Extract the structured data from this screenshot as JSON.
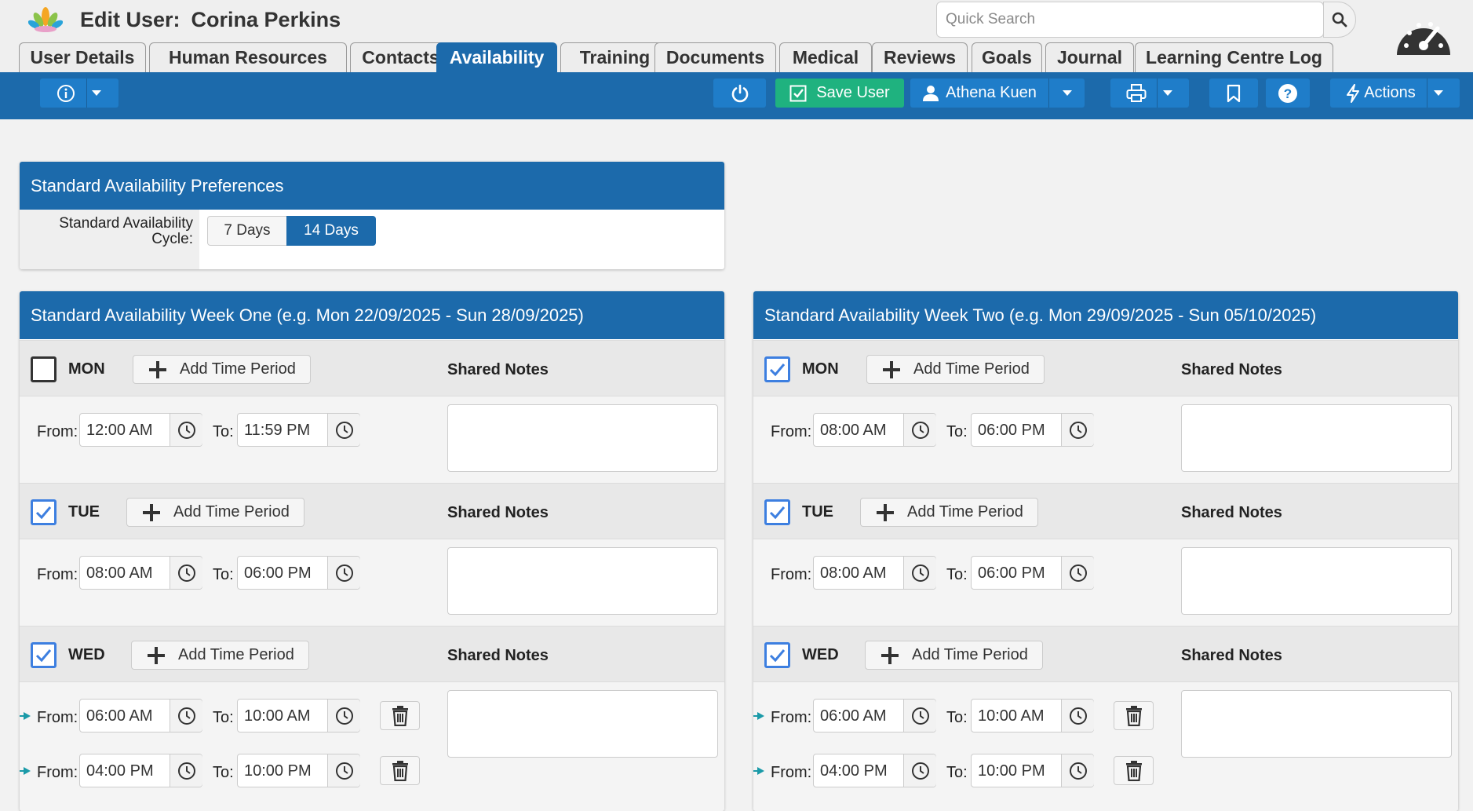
{
  "header": {
    "title_prefix": "Edit User:",
    "user_name": "Corina Perkins",
    "search_placeholder": "Quick Search"
  },
  "tabs": [
    {
      "label": "User Details"
    },
    {
      "label": "Human Resources"
    },
    {
      "label": "Contacts"
    },
    {
      "label": "Availability",
      "active": true
    },
    {
      "label": "Training"
    },
    {
      "label": "Documents"
    },
    {
      "label": "Medical"
    },
    {
      "label": "Reviews"
    },
    {
      "label": "Goals"
    },
    {
      "label": "Journal"
    },
    {
      "label": "Learning Centre Log"
    }
  ],
  "toolbar": {
    "save_label": "Save User",
    "user_label": "Athena Kuen",
    "actions_label": "Actions"
  },
  "preferences": {
    "title": "Standard Availability Preferences",
    "cycle_label_line1": "Standard Availability",
    "cycle_label_line2": "Cycle:",
    "option_7": "7 Days",
    "option_14": "14 Days",
    "selected": "14 Days"
  },
  "labels": {
    "add_time_period": "Add Time Period",
    "shared_notes": "Shared Notes",
    "from": "From:",
    "to": "To:"
  },
  "week_one": {
    "title": "Standard Availability Week One (e.g. Mon 22/09/2025 - Sun 28/09/2025)",
    "days": [
      {
        "day": "MON",
        "checked": false,
        "periods": [
          {
            "from": "12:00 AM",
            "to": "11:59 PM"
          }
        ]
      },
      {
        "day": "TUE",
        "checked": true,
        "periods": [
          {
            "from": "08:00 AM",
            "to": "06:00 PM"
          }
        ]
      },
      {
        "day": "WED",
        "checked": true,
        "periods": [
          {
            "from": "06:00 AM",
            "to": "10:00 AM"
          },
          {
            "from": "04:00 PM",
            "to": "10:00 PM"
          }
        ]
      }
    ]
  },
  "week_two": {
    "title": "Standard Availability Week Two (e.g. Mon 29/09/2025 - Sun 05/10/2025)",
    "days": [
      {
        "day": "MON",
        "checked": true,
        "periods": [
          {
            "from": "08:00 AM",
            "to": "06:00 PM"
          }
        ]
      },
      {
        "day": "TUE",
        "checked": true,
        "periods": [
          {
            "from": "08:00 AM",
            "to": "06:00 PM"
          }
        ]
      },
      {
        "day": "WED",
        "checked": true,
        "periods": [
          {
            "from": "06:00 AM",
            "to": "10:00 AM"
          },
          {
            "from": "04:00 PM",
            "to": "10:00 PM"
          }
        ]
      }
    ]
  },
  "colors": {
    "brand_blue": "#1c6aab",
    "button_blue": "#1f7dc9",
    "save_green": "#1fb27f",
    "checkbox_blue": "#3d7fe0",
    "arrow_teal": "#1a9aa8"
  }
}
